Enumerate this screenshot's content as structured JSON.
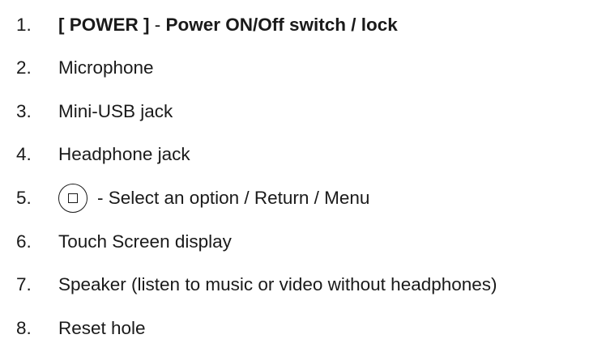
{
  "items": [
    {
      "number": "1.",
      "label_bold_prefix": "[ POWER ]",
      "separator": " - ",
      "label_bold_suffix": "Power ON/Off switch / lock"
    },
    {
      "number": "2.",
      "label": "Microphone"
    },
    {
      "number": "3.",
      "label": "Mini-USB jack"
    },
    {
      "number": "4.",
      "label": "Headphone jack"
    },
    {
      "number": "5.",
      "icon": "menu-button-icon",
      "label": "- Select an option / Return / Menu"
    },
    {
      "number": "6.",
      "label": "Touch Screen display"
    },
    {
      "number": "7.",
      "label": "Speaker (listen to music or video without headphones)"
    },
    {
      "number": "8.",
      "label": "Reset hole"
    }
  ]
}
